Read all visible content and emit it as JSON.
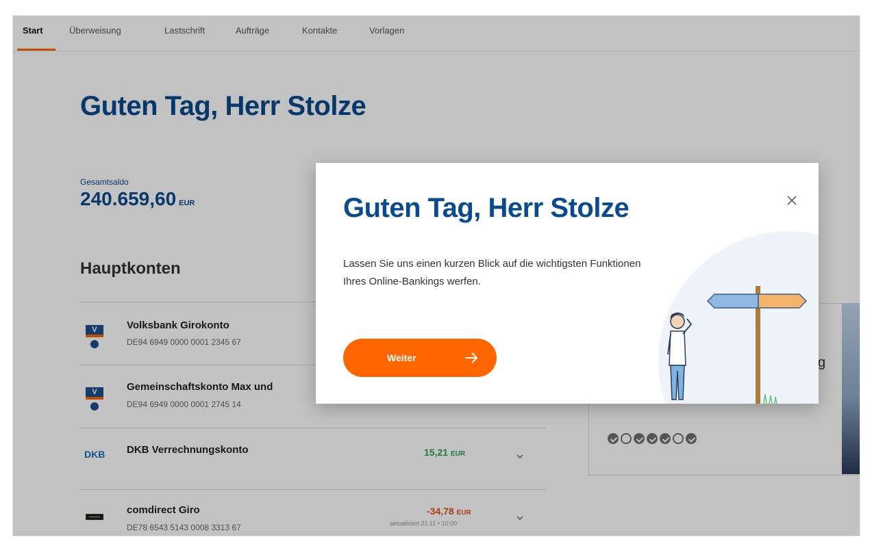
{
  "nav": {
    "items": [
      {
        "label": "Start",
        "active": true
      },
      {
        "label": "Überweisung"
      },
      {
        "label": "Lastschrift"
      },
      {
        "label": "Aufträge"
      },
      {
        "label": "Kontakte"
      },
      {
        "label": "Vorlagen"
      }
    ]
  },
  "page": {
    "greeting": "Guten Tag, Herr Stolze",
    "total_label": "Gesamtsaldo",
    "total_value": "240.659,60",
    "total_currency": "EUR",
    "section_title": "Hauptkonten"
  },
  "accounts": [
    {
      "name": "Volksbank Girokonto",
      "iban": "DE94 6949 0000 0001 2345 67",
      "logo": "volksbank-logo"
    },
    {
      "name": "Gemeinschaftskonto Max und",
      "iban": "DE94 6949 0000 0001 2745 14",
      "logo": "volksbank-logo"
    },
    {
      "name": "DKB Verrechnungskonto",
      "iban": "",
      "amount": "15,21",
      "currency": "EUR",
      "logo": "dkb-logo",
      "logo_text": "DKB"
    },
    {
      "name": "comdirect Giro",
      "iban": "DE78 6543 5143 0008 3313 67",
      "amount": "-34,78",
      "currency": "EUR",
      "updated": "aktualisiert 21.11 • 10:00",
      "logo": "comdirect-logo"
    }
  ],
  "side_card": {
    "visible_letter": "g",
    "progress_steps": [
      true,
      false,
      true,
      true,
      true,
      false,
      true
    ]
  },
  "modal": {
    "title": "Guten Tag, Herr Stolze",
    "text": "Lassen Sie uns einen kurzen Blick auf die wichtigsten Funktionen Ihres Online-Bankings werfen.",
    "cta_label": "Weiter",
    "close_icon": "close-icon",
    "illustration": "person-at-signpost"
  },
  "colors": {
    "brand_blue": "#0a4a8f",
    "accent_orange": "#ff6600",
    "positive": "#2aa052",
    "negative": "#e2531c"
  }
}
